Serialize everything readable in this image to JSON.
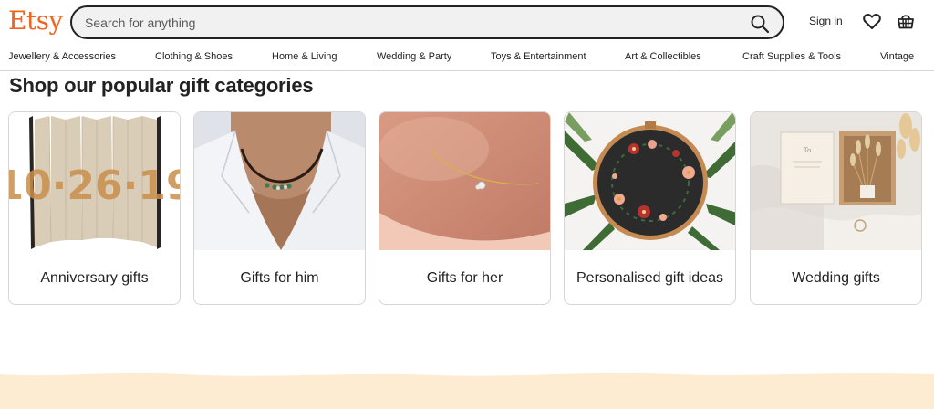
{
  "header": {
    "logo": "Etsy",
    "search_placeholder": "Search for anything",
    "signin_label": "Sign in"
  },
  "nav": {
    "items": [
      "Jewellery & Accessories",
      "Clothing & Shoes",
      "Home & Living",
      "Wedding & Party",
      "Toys & Entertainment",
      "Art & Collectibles",
      "Craft Supplies & Tools",
      "Vintage"
    ]
  },
  "main": {
    "title": "Shop our popular gift categories",
    "cards": [
      {
        "label": "Anniversary gifts",
        "image": "folded-book-art"
      },
      {
        "label": "Gifts for him",
        "image": "beaded-necklace"
      },
      {
        "label": "Gifts for her",
        "image": "gold-anklet"
      },
      {
        "label": "Personalised gift ideas",
        "image": "embroidery-hoop"
      },
      {
        "label": "Wedding gifts",
        "image": "gift-box-dried-flowers"
      }
    ]
  },
  "colors": {
    "brand": "#f1641e",
    "footer_band": "#fdebd2"
  }
}
